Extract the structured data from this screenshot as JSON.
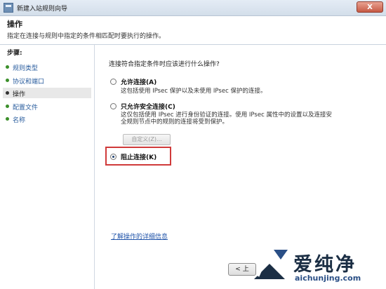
{
  "window": {
    "title": "新建入站规则向导",
    "close_label": "X"
  },
  "header": {
    "title": "操作",
    "description": "指定在连接与规则中指定的条件相匹配时要执行的操作。"
  },
  "sidebar": {
    "steps_title": "步骤:",
    "items": [
      {
        "label": "规则类型",
        "current": false
      },
      {
        "label": "协议和端口",
        "current": false
      },
      {
        "label": "操作",
        "current": true
      },
      {
        "label": "配置文件",
        "current": false
      },
      {
        "label": "名称",
        "current": false
      }
    ]
  },
  "main": {
    "question": "连接符合指定条件时应该进行什么操作?",
    "options": [
      {
        "label": "允许连接(A)",
        "description": "这包括使用 IPsec 保护以及未使用 IPsec 保护的连接。",
        "checked": false
      },
      {
        "label": "只允许安全连接(C)",
        "description_line1": "这仅包括使用 IPsec 进行身份验证的连接。使用 IPsec 属性中的设置以及连接安",
        "description_line2": "全规则节点中的规则的连接将受到保护。",
        "checked": false
      },
      {
        "label": "阻止连接(K)",
        "checked": true
      }
    ],
    "customize_label": "自定义(Z)...",
    "learn_more_link": "了解操作的详细信息"
  },
  "footer": {
    "back_label": "< 上"
  },
  "watermark": {
    "text": "爱纯净",
    "url": "aichunjing.com"
  },
  "colors": {
    "highlight": "#d03a3a",
    "link": "#2255aa",
    "step_bullet": "#3b8f2a"
  }
}
